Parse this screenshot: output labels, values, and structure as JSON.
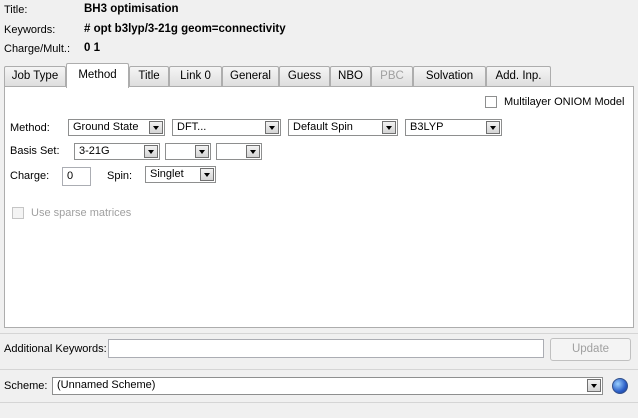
{
  "header": {
    "title_label": "Title:",
    "title_value": "BH3 optimisation",
    "keywords_label": "Keywords:",
    "keywords_value": "# opt b3lyp/3-21g geom=connectivity",
    "charge_label": "Charge/Mult.:",
    "charge_value": "0 1"
  },
  "tabs": [
    {
      "label": "Job Type",
      "state": "normal"
    },
    {
      "label": "Method",
      "state": "active"
    },
    {
      "label": "Title",
      "state": "normal"
    },
    {
      "label": "Link 0",
      "state": "normal"
    },
    {
      "label": "General",
      "state": "normal"
    },
    {
      "label": "Guess",
      "state": "normal"
    },
    {
      "label": "NBO",
      "state": "normal"
    },
    {
      "label": "PBC",
      "state": "disabled"
    },
    {
      "label": "Solvation",
      "state": "normal"
    },
    {
      "label": "Add. Inp.",
      "state": "normal"
    }
  ],
  "method_panel": {
    "oniom_label": "Multilayer ONIOM Model",
    "method_label": "Method:",
    "method_state": "Ground State",
    "method_type": "DFT...",
    "spin_mode": "Default Spin",
    "functional": "B3LYP",
    "basis_label": "Basis Set:",
    "basis_value": "3-21G",
    "basis_extra1": "",
    "basis_extra2": "",
    "charge_label": "Charge:",
    "charge_value": "0",
    "spin_label": "Spin:",
    "spin_value": "Singlet",
    "sparse_label": "Use sparse matrices"
  },
  "additional": {
    "label": "Additional Keywords:",
    "value": "",
    "update_label": "Update"
  },
  "scheme": {
    "label": "Scheme:",
    "value": "(Unnamed Scheme)"
  },
  "icons": {
    "scheme_help": "globe-help-icon"
  }
}
